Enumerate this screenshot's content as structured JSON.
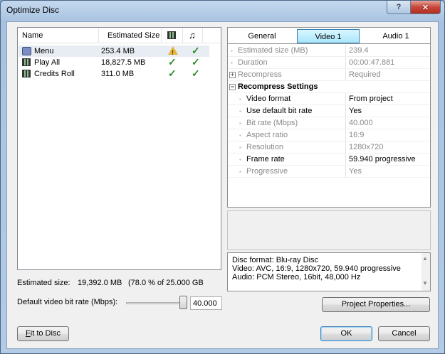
{
  "window": {
    "title": "Optimize Disc",
    "help_glyph": "?",
    "close_glyph": "✕"
  },
  "list": {
    "columns": {
      "name": "Name",
      "size": "Estimated Size",
      "video_icon": "film-icon",
      "audio_icon": "music-note-icon"
    },
    "rows": [
      {
        "name": "Menu",
        "size": "253.4 MB",
        "icon": "menu-icon",
        "video_status": "warning",
        "audio_status": "ok",
        "selected": true
      },
      {
        "name": "Play All",
        "size": "18,827.5 MB",
        "icon": "film-icon",
        "video_status": "ok",
        "audio_status": "ok",
        "selected": false
      },
      {
        "name": "Credits Roll",
        "size": "311.0 MB",
        "icon": "film-icon",
        "video_status": "ok",
        "audio_status": "ok",
        "selected": false
      }
    ],
    "warning_glyph": "!",
    "check_glyph": "✓"
  },
  "tabs": [
    {
      "label": "General",
      "active": false
    },
    {
      "label": "Video 1",
      "active": true
    },
    {
      "label": "Audio 1",
      "active": false
    }
  ],
  "properties": {
    "estimated_size": {
      "label": "Estimated size (MB)",
      "value": "239.4"
    },
    "duration": {
      "label": "Duration",
      "value": "00:00:47.881"
    },
    "recompress": {
      "label": "Recompress",
      "value": "Required",
      "expander": "+"
    },
    "section": {
      "label": "Recompress Settings",
      "expander": "−"
    },
    "video_format": {
      "label": "Video format",
      "value": "From project"
    },
    "default_bitrate": {
      "label": "Use default bit rate",
      "value": "Yes"
    },
    "bit_rate": {
      "label": "Bit rate (Mbps)",
      "value": "40.000"
    },
    "aspect_ratio": {
      "label": "Aspect ratio",
      "value": "16:9"
    },
    "resolution": {
      "label": "Resolution",
      "value": "1280x720"
    },
    "frame_rate": {
      "label": "Frame rate",
      "value": "59.940 progressive"
    },
    "progressive": {
      "label": "Progressive",
      "value": "Yes"
    }
  },
  "info": {
    "disc_format": "Disc format:  Blu-ray Disc",
    "video": "Video:  AVC, 16:9, 1280x720, 59.940 progressive",
    "audio": "Audio: PCM Stereo, 16bit, 48,000 Hz",
    "scroll_up": "▲",
    "scroll_down": "▼"
  },
  "summary": {
    "estimated_label": "Estimated size:",
    "estimated_value": "19,392.0 MB",
    "estimated_extra": "(78.0 % of 25.000 GB",
    "bitrate_label": "Default video bit rate (Mbps):",
    "bitrate_value": "40.000",
    "bitrate_level": 1.0
  },
  "buttons": {
    "project_properties": "Project Properties...",
    "fit_to_disc": "Fit to Disc",
    "ok": "OK",
    "cancel": "Cancel"
  }
}
